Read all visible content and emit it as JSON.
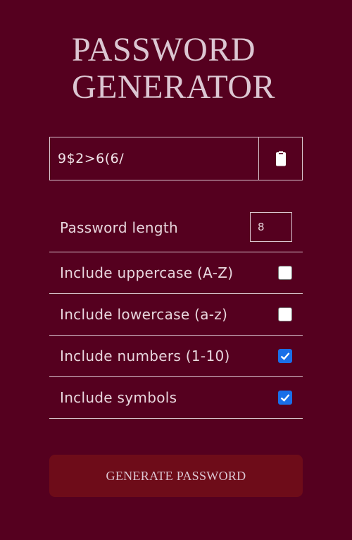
{
  "header": {
    "title_line1": "PASSWORD",
    "title_line2": "GENERATOR"
  },
  "result": {
    "password": "9$2>6(6/",
    "copy_icon": "clipboard-icon"
  },
  "settings": {
    "length": {
      "label": "Password length",
      "value": "8"
    },
    "uppercase": {
      "label": "Include uppercase (A-Z)",
      "checked": false
    },
    "lowercase": {
      "label": "Include lowercase (a-z)",
      "checked": false
    },
    "numbers": {
      "label": "Include numbers (1-10)",
      "checked": true
    },
    "symbols": {
      "label": "Include symbols",
      "checked": true
    }
  },
  "generate": {
    "label": "GENERATE PASSWORD"
  },
  "colors": {
    "background": "#55001f",
    "button": "#6e0c19",
    "text": "#dcc6d2",
    "checkbox_checked": "#1a6fe8"
  }
}
